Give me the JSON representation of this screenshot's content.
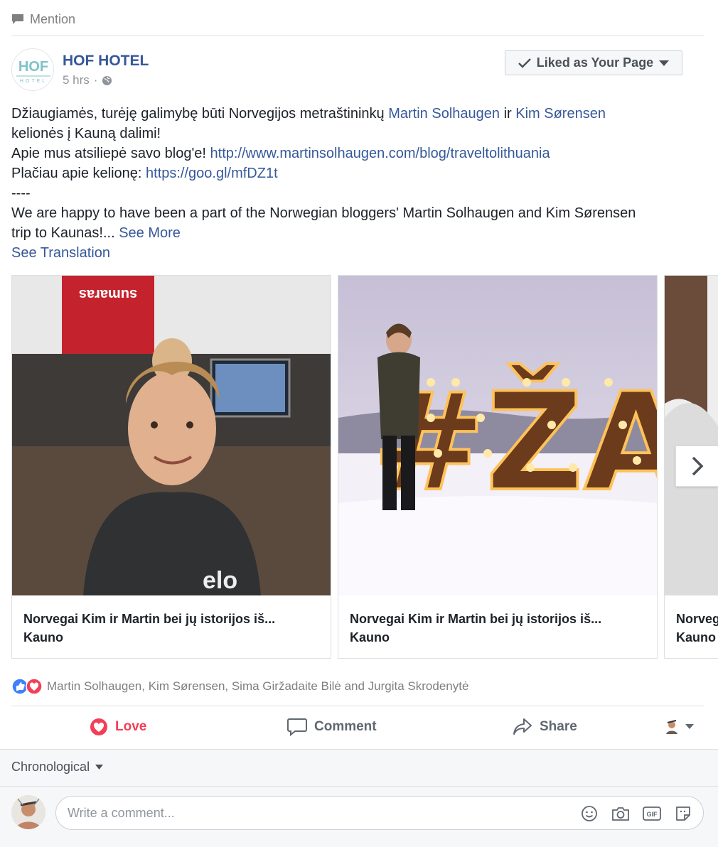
{
  "mention": {
    "label": "Mention"
  },
  "post": {
    "page_name": "HOF HOTEL",
    "time": "5 hrs",
    "time_sep": "·",
    "liked_button": "Liked as Your Page",
    "logo_text": "HOF",
    "logo_sub": "HOTEL",
    "text": {
      "line1_a": "Džiaugiamės, turėję galimybę būti Norvegijos metraštininkų ",
      "line1_link1": "Martin Solhaugen",
      "line1_b": " ir ",
      "line1_link2": "Kim Sørensen",
      "line2": "kelionės į Kauną dalimi!",
      "line3_a": "Apie mus atsiliepė savo blog'e! ",
      "line3_link": "http://www.martinsolhaugen.com/blog/traveltolithuania",
      "line4_a": "Plačiau apie kelionę: ",
      "line4_link": "https://goo.gl/mfDZ1t",
      "line5": "----",
      "line6": "We are happy to have been a part of the Norwegian bloggers' Martin Solhaugen and Kim Sørensen",
      "line7_a": "trip to Kaunas!... ",
      "line7_link": "See More",
      "see_translation": "See Translation"
    }
  },
  "carousel": {
    "cards": [
      {
        "title": "Norvegai Kim ir Martin bei jų istorijos iš...",
        "subtitle": "Kauno"
      },
      {
        "title": "Norvegai Kim ir Martin bei jų istorijos iš...",
        "subtitle": "Kauno"
      },
      {
        "title": "Norveg",
        "subtitle": "Kauno"
      }
    ],
    "sign_text": "#ŽA",
    "shirt_text": "sumaras"
  },
  "reactions": {
    "names": "Martin Solhaugen, Kim Sørensen, Sima Giržadaite Bilė and Jurgita Skrodenytė"
  },
  "actions": {
    "love": "Love",
    "comment": "Comment",
    "share": "Share"
  },
  "comments": {
    "sort_label": "Chronological",
    "placeholder": "Write a comment..."
  },
  "colors": {
    "link": "#365899",
    "love": "#f33e58",
    "like_blue": "#1877f2",
    "muted": "#90949c"
  },
  "icons": [
    "comment-bubble-icon",
    "globe-icon",
    "checkmark-icon",
    "caret-down-icon",
    "chevron-right-icon",
    "like-reaction-icon",
    "love-reaction-icon",
    "heart-icon",
    "comment-icon",
    "share-icon",
    "emoji-icon",
    "camera-icon",
    "gif-icon",
    "sticker-icon"
  ]
}
